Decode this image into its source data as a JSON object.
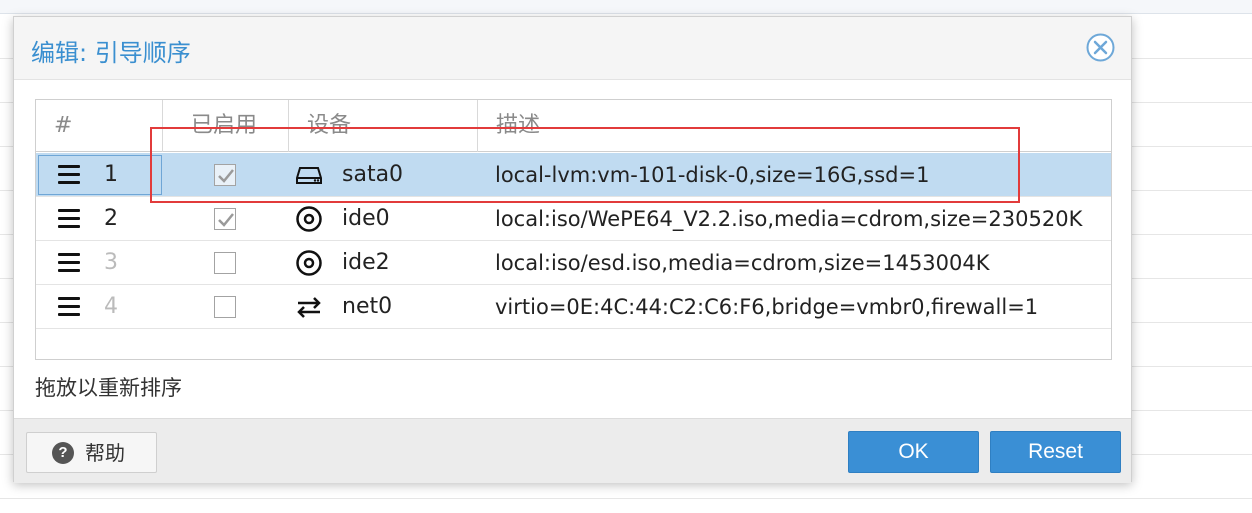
{
  "dialog": {
    "title": "编辑: 引导顺序",
    "close_icon": "close-circle-icon"
  },
  "grid": {
    "columns": [
      "#",
      "已启用",
      "设备",
      "描述"
    ],
    "rows": [
      {
        "order": "1",
        "enabled": true,
        "device_icon": "harddisk-icon",
        "device": "sata0",
        "description": "local-lvm:vm-101-disk-0,size=16G,ssd=1",
        "selected": true
      },
      {
        "order": "2",
        "enabled": true,
        "device_icon": "cdrom-icon",
        "device": "ide0",
        "description": "local:iso/WePE64_V2.2.iso,media=cdrom,size=230520K",
        "selected": false
      },
      {
        "order": "3",
        "enabled": false,
        "device_icon": "cdrom-icon",
        "device": "ide2",
        "description": "local:iso/esd.iso,media=cdrom,size=1453004K",
        "selected": false
      },
      {
        "order": "4",
        "enabled": false,
        "device_icon": "network-exchange-icon",
        "device": "net0",
        "description": "virtio=0E:4C:44:C2:C6:F6,bridge=vmbr0,firewall=1",
        "selected": false
      }
    ]
  },
  "hint": "拖放以重新排序",
  "footer": {
    "help_label": "帮助",
    "ok_label": "OK",
    "reset_label": "Reset"
  },
  "colors": {
    "accent": "#3a8fd5",
    "selected_row": "#c0dbf1",
    "annotation_box": "#e23b3b"
  }
}
